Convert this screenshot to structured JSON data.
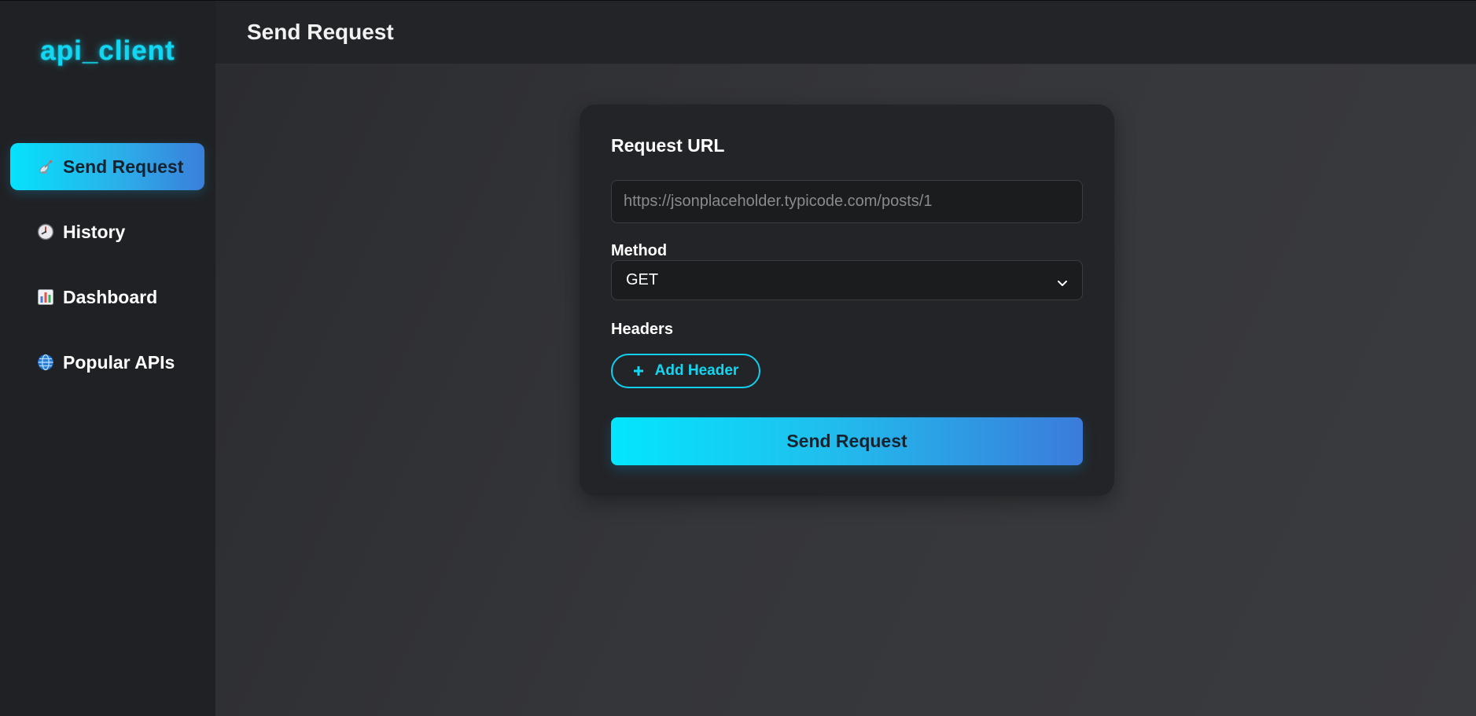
{
  "app": {
    "brand": "api_client",
    "accent_color": "#12d6f2",
    "gradient_colors": [
      "#03e6fd",
      "#3b7bdb"
    ]
  },
  "sidebar": {
    "items": [
      {
        "label": "Send Request",
        "icon": "satellite-antenna-icon",
        "active": true
      },
      {
        "label": "History",
        "icon": "clock-icon",
        "active": false
      },
      {
        "label": "Dashboard",
        "icon": "bar-chart-icon",
        "active": false
      },
      {
        "label": "Popular APIs",
        "icon": "globe-icon",
        "active": false
      }
    ]
  },
  "header": {
    "title": "Send Request"
  },
  "form": {
    "url_label": "Request URL",
    "url_value": "",
    "url_placeholder": "https://jsonplaceholder.typicode.com/posts/1",
    "method_label": "Method",
    "method_selected": "GET",
    "headers_label": "Headers",
    "add_header_label": "Add Header",
    "send_label": "Send Request"
  }
}
